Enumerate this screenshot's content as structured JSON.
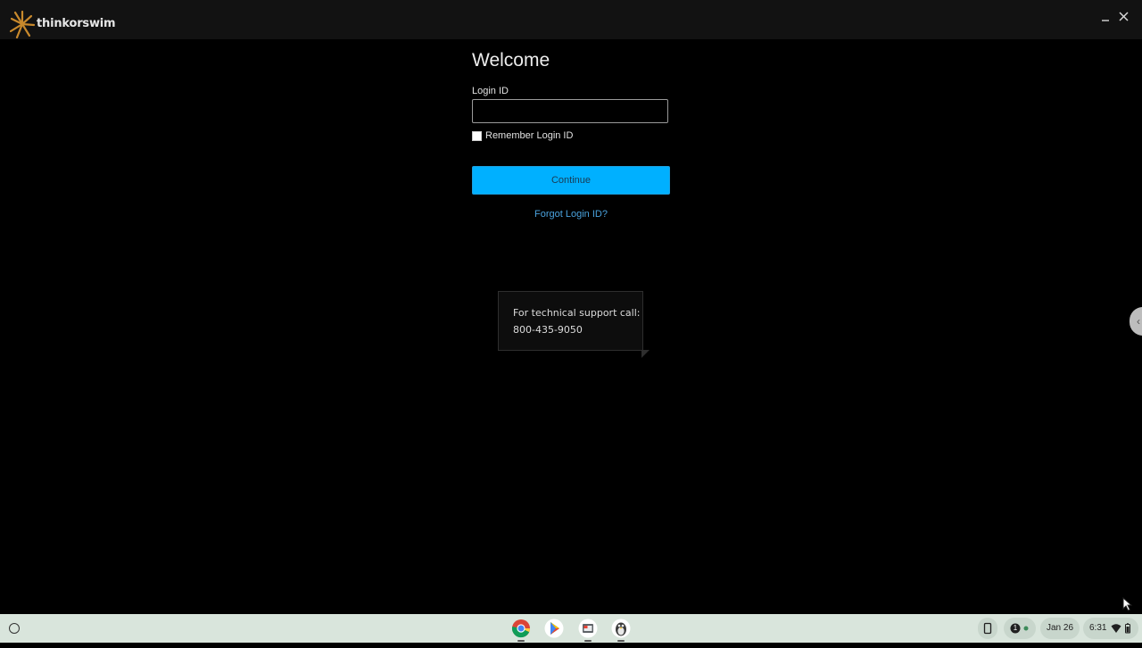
{
  "window": {
    "app_name": "thinkorswim",
    "brand_color": "#c8892c",
    "minimize_icon": "minimize-icon",
    "close_icon": "close-icon"
  },
  "login": {
    "welcome": "Welcome",
    "login_id_label": "Login ID",
    "login_id_value": "",
    "remember_label": "Remember Login ID",
    "remember_checked": false,
    "continue_label": "Continue",
    "continue_color": "#00b0ff",
    "forgot_label": "Forgot Login ID?",
    "link_color": "#4aa3df"
  },
  "support": {
    "line1": "For technical support call:",
    "phone": "800-435-9050"
  },
  "shelf": {
    "launcher_icon": "launcher-icon",
    "apps": [
      "chrome-icon",
      "play-store-icon",
      "files-icon",
      "linux-penguin-icon"
    ],
    "notification_count": "1",
    "date": "Jan 26",
    "time": "6:31"
  }
}
